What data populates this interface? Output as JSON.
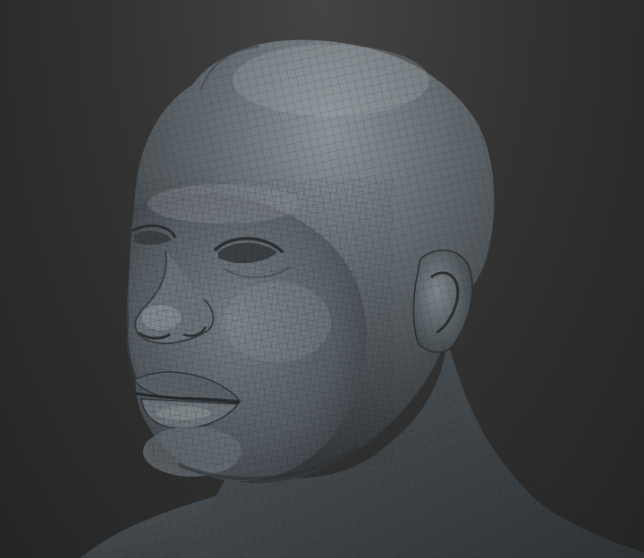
{
  "viewport": {
    "background_top": "#444444",
    "background_bottom": "#242424"
  },
  "model": {
    "icon": "sculpt-mesh-head",
    "material_base": "#5f666b",
    "material_highlight": "#9aa3a8",
    "material_shadow": "#2c3033",
    "wireframe_color": "#1f2326",
    "wireframe_visible": true
  }
}
